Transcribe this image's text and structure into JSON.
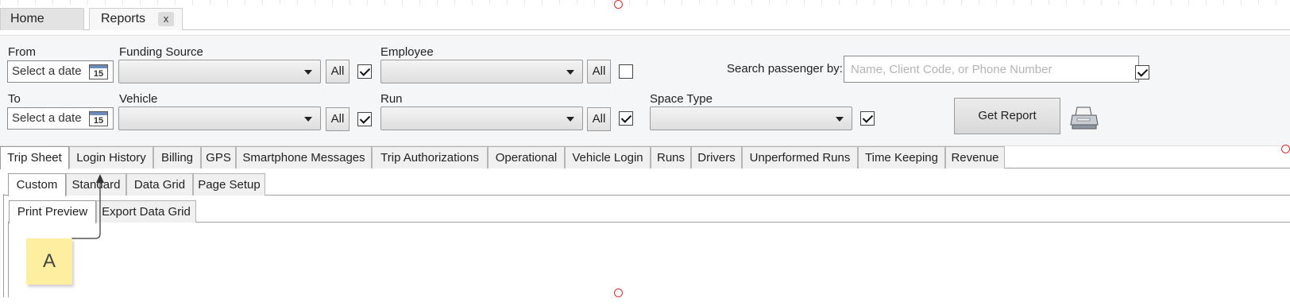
{
  "doc_tabs": {
    "home": "Home",
    "reports": "Reports",
    "close": "x"
  },
  "filters": {
    "from_label": "From",
    "to_label": "To",
    "date_placeholder": "Select a date",
    "calendar_day": "15",
    "funding_source_label": "Funding Source",
    "vehicle_label": "Vehicle",
    "employee_label": "Employee",
    "run_label": "Run",
    "space_type_label": "Space Type",
    "all_label": "All",
    "search_label": "Search passenger by:",
    "search_placeholder": "Name, Client Code, or Phone Number",
    "get_report": "Get Report"
  },
  "report_tabs": [
    "Trip Sheet",
    "Login History",
    "Billing",
    "GPS",
    "Smartphone Messages",
    "Trip Authorizations",
    "Operational",
    "Vehicle Login",
    "Runs",
    "Drivers",
    "Unperformed Runs",
    "Time Keeping",
    "Revenue"
  ],
  "sub_tabs": [
    "Custom",
    "Standard",
    "Data Grid",
    "Page Setup"
  ],
  "sub_sub_tabs": [
    "Print Preview",
    "Export Data Grid"
  ],
  "annotation": {
    "label": "A"
  },
  "colors": {
    "panel_bg": "#f4f6f8",
    "sticky": "#fdeea0",
    "handle": "#d03030"
  }
}
